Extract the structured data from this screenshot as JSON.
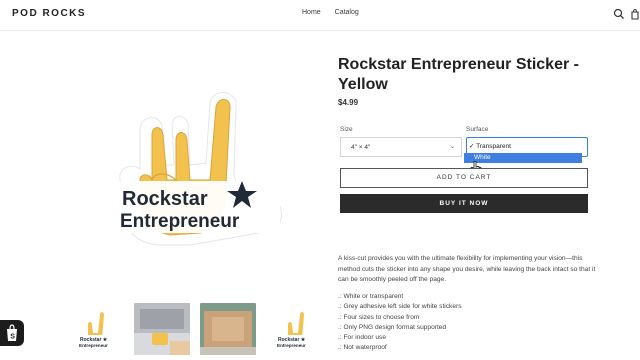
{
  "header": {
    "brand": "POD ROCKS",
    "nav": [
      "Home",
      "Catalog"
    ],
    "icons": [
      "search-icon",
      "cart-icon"
    ]
  },
  "product": {
    "title": "Rockstar Entrepreneur Sticker - Yellow",
    "price": "$4.99",
    "sticker_text_line1": "Rockstar",
    "sticker_text_line2": "Entrepreneur"
  },
  "options": {
    "size_label": "Size",
    "size_value": "4\" × 4\"",
    "surface_label": "Surface",
    "surface_options": [
      "✓ Transparent",
      "White"
    ],
    "surface_highlighted": "White"
  },
  "buttons": {
    "add_to_cart": "ADD TO CART",
    "buy_now": "BUY IT NOW"
  },
  "description": "A kiss-cut provides you with the ultimate flexibility for implementing your vision—this method cuts the sticker into any shape you desire, while leaving the back intact so that it can be smoothly peeled off the page.",
  "features": [
    ".: White or transparent",
    ".: Grey adhesive left side for white stickers",
    ".: Four sizes to choose from",
    ".: Only PNG design format supported",
    ".: For indoor use",
    ".: Not waterproof"
  ],
  "colors": {
    "accent_blue": "#3f7fe0",
    "sticker_yellow": "#f2c14e",
    "button_dark": "#2b2b2b"
  }
}
